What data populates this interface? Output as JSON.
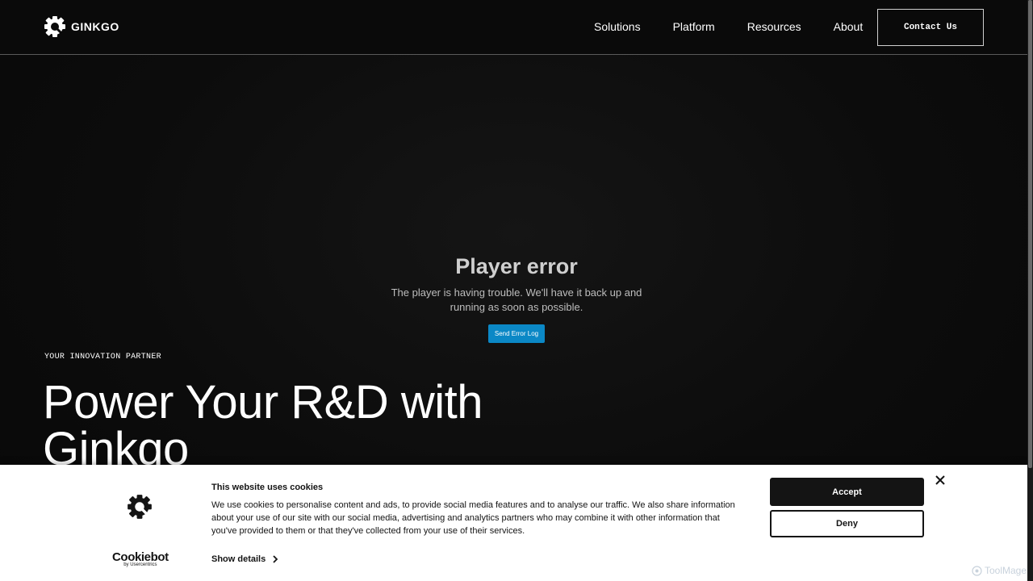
{
  "header": {
    "brand": "GINKGO",
    "nav": [
      "Solutions",
      "Platform",
      "Resources",
      "About"
    ],
    "contact": "Contact Us"
  },
  "player": {
    "title": "Player error",
    "message": "The player is having trouble. We'll have it back up and running as soon as possible.",
    "button": "Send Error Log"
  },
  "hero": {
    "eyebrow": "YOUR INNOVATION PARTNER",
    "title": "Power Your R&D with Ginkgo"
  },
  "cookie": {
    "title": "This website uses cookies",
    "text": "We use cookies to personalise content and ads, to provide social media features and to analyse our traffic. We also share information about your use of our site with our social media, advertising and analytics partners who may combine it with other information that you've provided to them or that they've collected from your use of their services.",
    "show_details": "Show details",
    "accept": "Accept",
    "deny": "Deny",
    "brand_name": "Cookiebot",
    "brand_sub": "by Usercentrics"
  },
  "watermark": "ToolMage",
  "colors": {
    "accent_blue": "#0b88c6",
    "dark": "#141414"
  }
}
